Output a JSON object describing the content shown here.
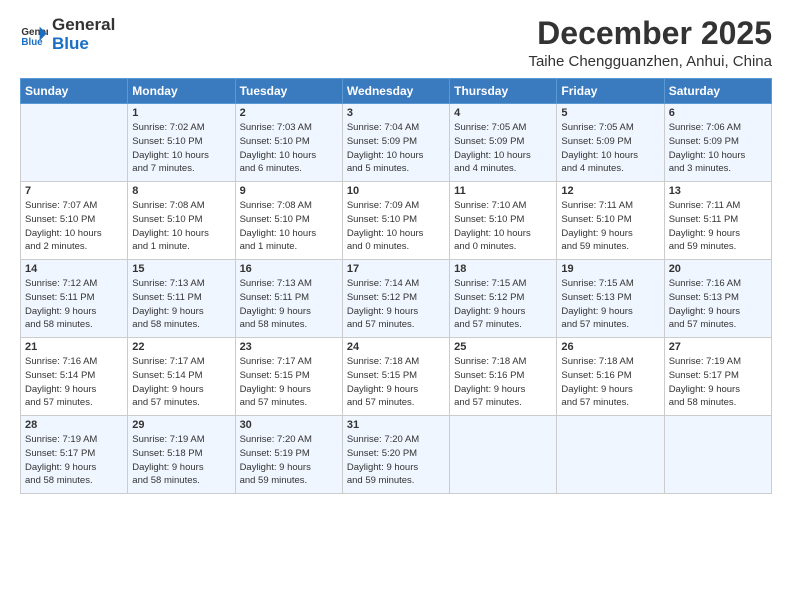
{
  "header": {
    "logo_general": "General",
    "logo_blue": "Blue",
    "month": "December 2025",
    "location": "Taihe Chengguanzhen, Anhui, China"
  },
  "weekdays": [
    "Sunday",
    "Monday",
    "Tuesday",
    "Wednesday",
    "Thursday",
    "Friday",
    "Saturday"
  ],
  "weeks": [
    [
      {
        "day": "",
        "info": ""
      },
      {
        "day": "1",
        "info": "Sunrise: 7:02 AM\nSunset: 5:10 PM\nDaylight: 10 hours\nand 7 minutes."
      },
      {
        "day": "2",
        "info": "Sunrise: 7:03 AM\nSunset: 5:10 PM\nDaylight: 10 hours\nand 6 minutes."
      },
      {
        "day": "3",
        "info": "Sunrise: 7:04 AM\nSunset: 5:09 PM\nDaylight: 10 hours\nand 5 minutes."
      },
      {
        "day": "4",
        "info": "Sunrise: 7:05 AM\nSunset: 5:09 PM\nDaylight: 10 hours\nand 4 minutes."
      },
      {
        "day": "5",
        "info": "Sunrise: 7:05 AM\nSunset: 5:09 PM\nDaylight: 10 hours\nand 4 minutes."
      },
      {
        "day": "6",
        "info": "Sunrise: 7:06 AM\nSunset: 5:09 PM\nDaylight: 10 hours\nand 3 minutes."
      }
    ],
    [
      {
        "day": "7",
        "info": "Sunrise: 7:07 AM\nSunset: 5:10 PM\nDaylight: 10 hours\nand 2 minutes."
      },
      {
        "day": "8",
        "info": "Sunrise: 7:08 AM\nSunset: 5:10 PM\nDaylight: 10 hours\nand 1 minute."
      },
      {
        "day": "9",
        "info": "Sunrise: 7:08 AM\nSunset: 5:10 PM\nDaylight: 10 hours\nand 1 minute."
      },
      {
        "day": "10",
        "info": "Sunrise: 7:09 AM\nSunset: 5:10 PM\nDaylight: 10 hours\nand 0 minutes."
      },
      {
        "day": "11",
        "info": "Sunrise: 7:10 AM\nSunset: 5:10 PM\nDaylight: 10 hours\nand 0 minutes."
      },
      {
        "day": "12",
        "info": "Sunrise: 7:11 AM\nSunset: 5:10 PM\nDaylight: 9 hours\nand 59 minutes."
      },
      {
        "day": "13",
        "info": "Sunrise: 7:11 AM\nSunset: 5:11 PM\nDaylight: 9 hours\nand 59 minutes."
      }
    ],
    [
      {
        "day": "14",
        "info": "Sunrise: 7:12 AM\nSunset: 5:11 PM\nDaylight: 9 hours\nand 58 minutes."
      },
      {
        "day": "15",
        "info": "Sunrise: 7:13 AM\nSunset: 5:11 PM\nDaylight: 9 hours\nand 58 minutes."
      },
      {
        "day": "16",
        "info": "Sunrise: 7:13 AM\nSunset: 5:11 PM\nDaylight: 9 hours\nand 58 minutes."
      },
      {
        "day": "17",
        "info": "Sunrise: 7:14 AM\nSunset: 5:12 PM\nDaylight: 9 hours\nand 57 minutes."
      },
      {
        "day": "18",
        "info": "Sunrise: 7:15 AM\nSunset: 5:12 PM\nDaylight: 9 hours\nand 57 minutes."
      },
      {
        "day": "19",
        "info": "Sunrise: 7:15 AM\nSunset: 5:13 PM\nDaylight: 9 hours\nand 57 minutes."
      },
      {
        "day": "20",
        "info": "Sunrise: 7:16 AM\nSunset: 5:13 PM\nDaylight: 9 hours\nand 57 minutes."
      }
    ],
    [
      {
        "day": "21",
        "info": "Sunrise: 7:16 AM\nSunset: 5:14 PM\nDaylight: 9 hours\nand 57 minutes."
      },
      {
        "day": "22",
        "info": "Sunrise: 7:17 AM\nSunset: 5:14 PM\nDaylight: 9 hours\nand 57 minutes."
      },
      {
        "day": "23",
        "info": "Sunrise: 7:17 AM\nSunset: 5:15 PM\nDaylight: 9 hours\nand 57 minutes."
      },
      {
        "day": "24",
        "info": "Sunrise: 7:18 AM\nSunset: 5:15 PM\nDaylight: 9 hours\nand 57 minutes."
      },
      {
        "day": "25",
        "info": "Sunrise: 7:18 AM\nSunset: 5:16 PM\nDaylight: 9 hours\nand 57 minutes."
      },
      {
        "day": "26",
        "info": "Sunrise: 7:18 AM\nSunset: 5:16 PM\nDaylight: 9 hours\nand 57 minutes."
      },
      {
        "day": "27",
        "info": "Sunrise: 7:19 AM\nSunset: 5:17 PM\nDaylight: 9 hours\nand 58 minutes."
      }
    ],
    [
      {
        "day": "28",
        "info": "Sunrise: 7:19 AM\nSunset: 5:17 PM\nDaylight: 9 hours\nand 58 minutes."
      },
      {
        "day": "29",
        "info": "Sunrise: 7:19 AM\nSunset: 5:18 PM\nDaylight: 9 hours\nand 58 minutes."
      },
      {
        "day": "30",
        "info": "Sunrise: 7:20 AM\nSunset: 5:19 PM\nDaylight: 9 hours\nand 59 minutes."
      },
      {
        "day": "31",
        "info": "Sunrise: 7:20 AM\nSunset: 5:20 PM\nDaylight: 9 hours\nand 59 minutes."
      },
      {
        "day": "",
        "info": ""
      },
      {
        "day": "",
        "info": ""
      },
      {
        "day": "",
        "info": ""
      }
    ]
  ]
}
